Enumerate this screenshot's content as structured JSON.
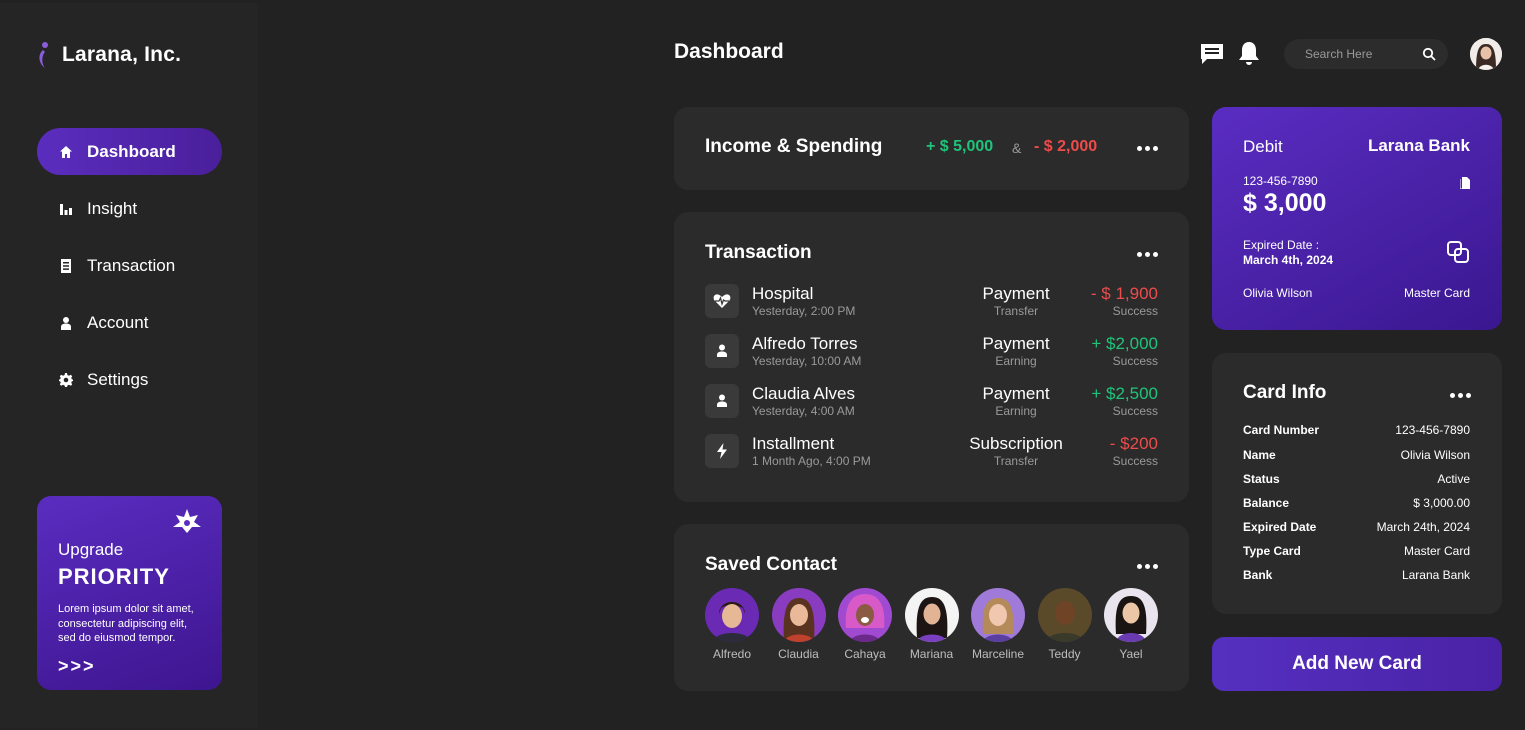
{
  "brand": {
    "name": "Larana, Inc."
  },
  "nav": [
    {
      "label": "Dashboard",
      "icon": "home-icon"
    },
    {
      "label": "Insight",
      "icon": "bar-chart-icon"
    },
    {
      "label": "Transaction",
      "icon": "document-icon"
    },
    {
      "label": "Account",
      "icon": "user-icon"
    },
    {
      "label": "Settings",
      "icon": "gear-icon"
    }
  ],
  "upgrade": {
    "line1": "Upgrade",
    "title": "PRIORITY",
    "text": "Lorem ipsum dolor sit amet, consectetur adipiscing elit, sed do eiusmod tempor.",
    "arrows": ">>>"
  },
  "header": {
    "title": "Dashboard",
    "search_placeholder": "Search Here"
  },
  "income": {
    "title": "Income & Spending",
    "income": "+ $ 5,000",
    "separator": "&",
    "spending": "- $ 2,000"
  },
  "transactions": {
    "title": "Transaction",
    "rows": [
      {
        "name": "Hospital",
        "date": "Yesterday, 2:00 PM",
        "type": "Payment",
        "sub": "Transfer",
        "amount": "- $ 1,900",
        "status": "Success",
        "icon": "heart-pulse-icon"
      },
      {
        "name": "Alfredo Torres",
        "date": "Yesterday, 10:00 AM",
        "type": "Payment",
        "sub": "Earning",
        "amount": "+ $2,000",
        "status": "Success",
        "icon": "user-icon"
      },
      {
        "name": "Claudia Alves",
        "date": "Yesterday, 4:00 AM",
        "type": "Payment",
        "sub": "Earning",
        "amount": "+ $2,500",
        "status": "Success",
        "icon": "user-icon"
      },
      {
        "name": "Installment",
        "date": "1 Month Ago, 4:00 PM",
        "type": "Subscription",
        "sub": "Transfer",
        "amount": "- $200",
        "status": "Success",
        "icon": "lightning-icon"
      }
    ]
  },
  "saved_contacts": {
    "title": "Saved Contact",
    "contacts": [
      "Alfredo",
      "Claudia",
      "Cahaya",
      "Mariana",
      "Marceline",
      "Teddy",
      "Yael"
    ]
  },
  "debit_card": {
    "label": "Debit",
    "bank": "Larana Bank",
    "number": "123-456-7890",
    "balance": "$ 3,000",
    "expired_label": "Expired Date :",
    "expired_value": "March 4th, 2024",
    "holder": "Olivia Wilson",
    "card_type": "Master Card"
  },
  "card_info": {
    "title": "Card Info",
    "rows": [
      {
        "key": "Card Number",
        "value": "123-456-7890"
      },
      {
        "key": "Name",
        "value": "Olivia Wilson"
      },
      {
        "key": "Status",
        "value": "Active"
      },
      {
        "key": "Balance",
        "value": "$ 3,000.00"
      },
      {
        "key": "Expired Date",
        "value": "March 24th, 2024"
      },
      {
        "key": "Type Card",
        "value": "Master Card"
      },
      {
        "key": "Bank",
        "value": "Larana Bank"
      }
    ]
  },
  "add_card": {
    "label": "Add New Card"
  },
  "colors": {
    "accent": "#5530c0",
    "income": "#1fc47a",
    "spending": "#ee4b4b"
  }
}
